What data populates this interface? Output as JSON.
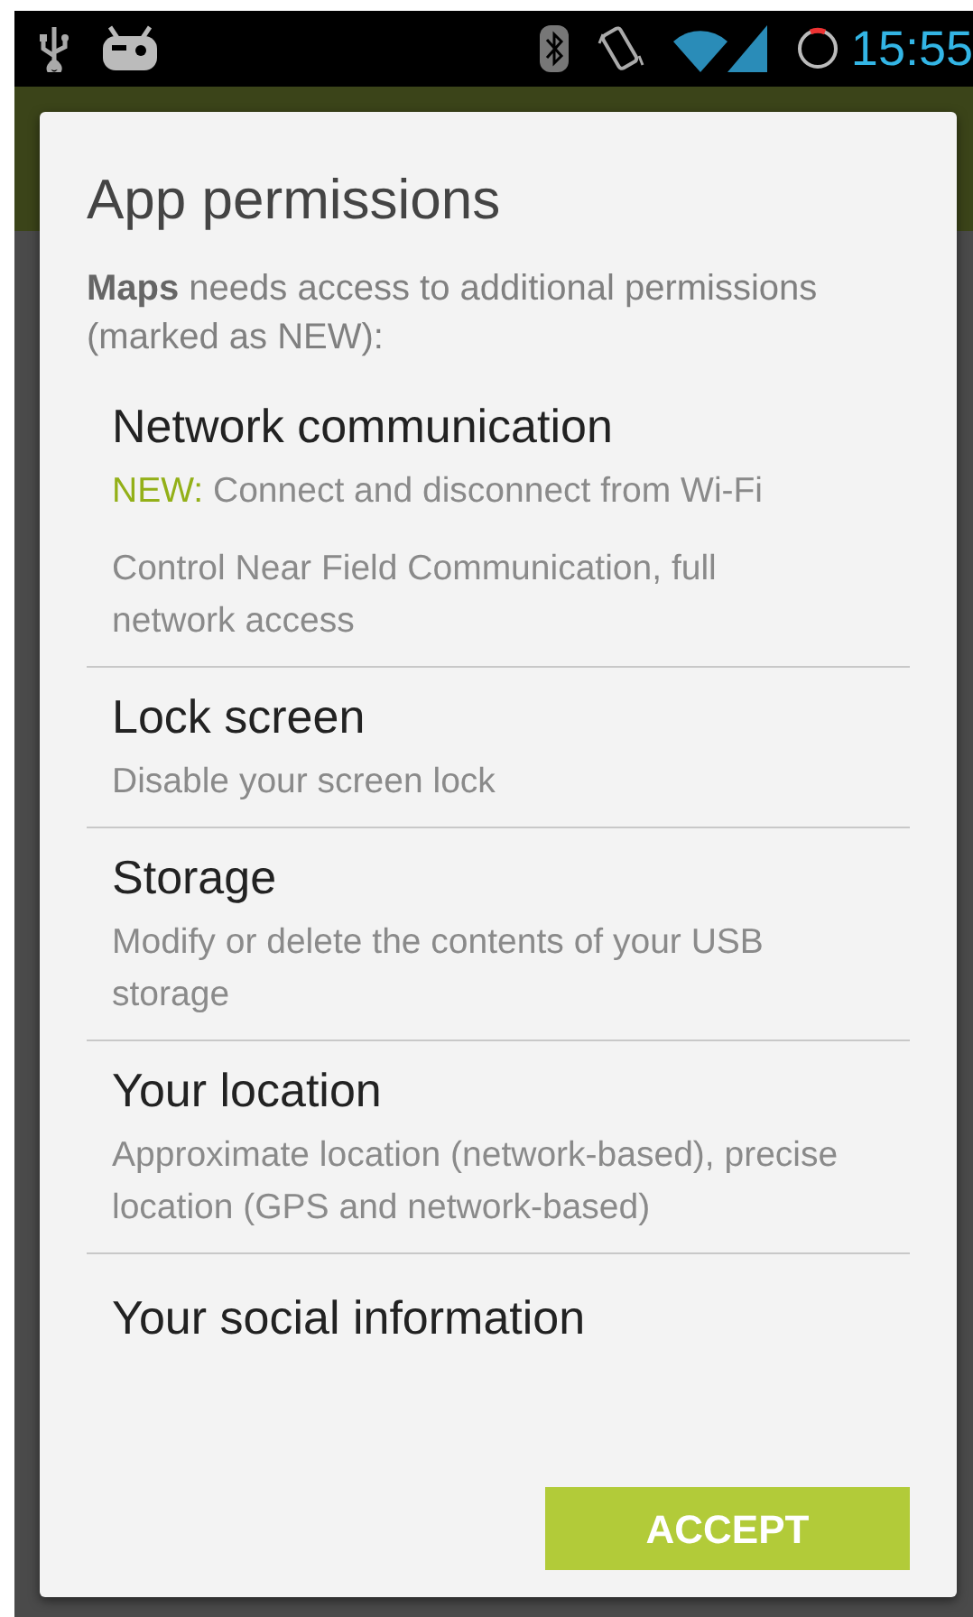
{
  "status_bar": {
    "time": "15:55"
  },
  "dialog": {
    "title": "App permissions",
    "intro": "**Maps** needs access to additional permissions (marked as NEW):",
    "groups": [
      {
        "title": "Network communication",
        "items": [
          {
            "kind": "new",
            "new_label": "NEW:",
            "text": "Connect and disconnect from Wi-Fi"
          },
          {
            "kind": "plain",
            "text": "Control Near Field Communication, full network access"
          }
        ]
      },
      {
        "title": "Lock screen",
        "items": [
          {
            "kind": "plain",
            "text": "Disable your screen lock"
          }
        ]
      },
      {
        "title": "Storage",
        "items": [
          {
            "kind": "plain",
            "text": "Modify or delete the contents of your USB storage"
          }
        ]
      },
      {
        "title": "Your location",
        "items": [
          {
            "kind": "plain",
            "text": "Approximate location (network-based), precise location (GPS and network-based)"
          }
        ]
      },
      {
        "title": "Your social information"
      }
    ],
    "button": "ACCEPT"
  }
}
